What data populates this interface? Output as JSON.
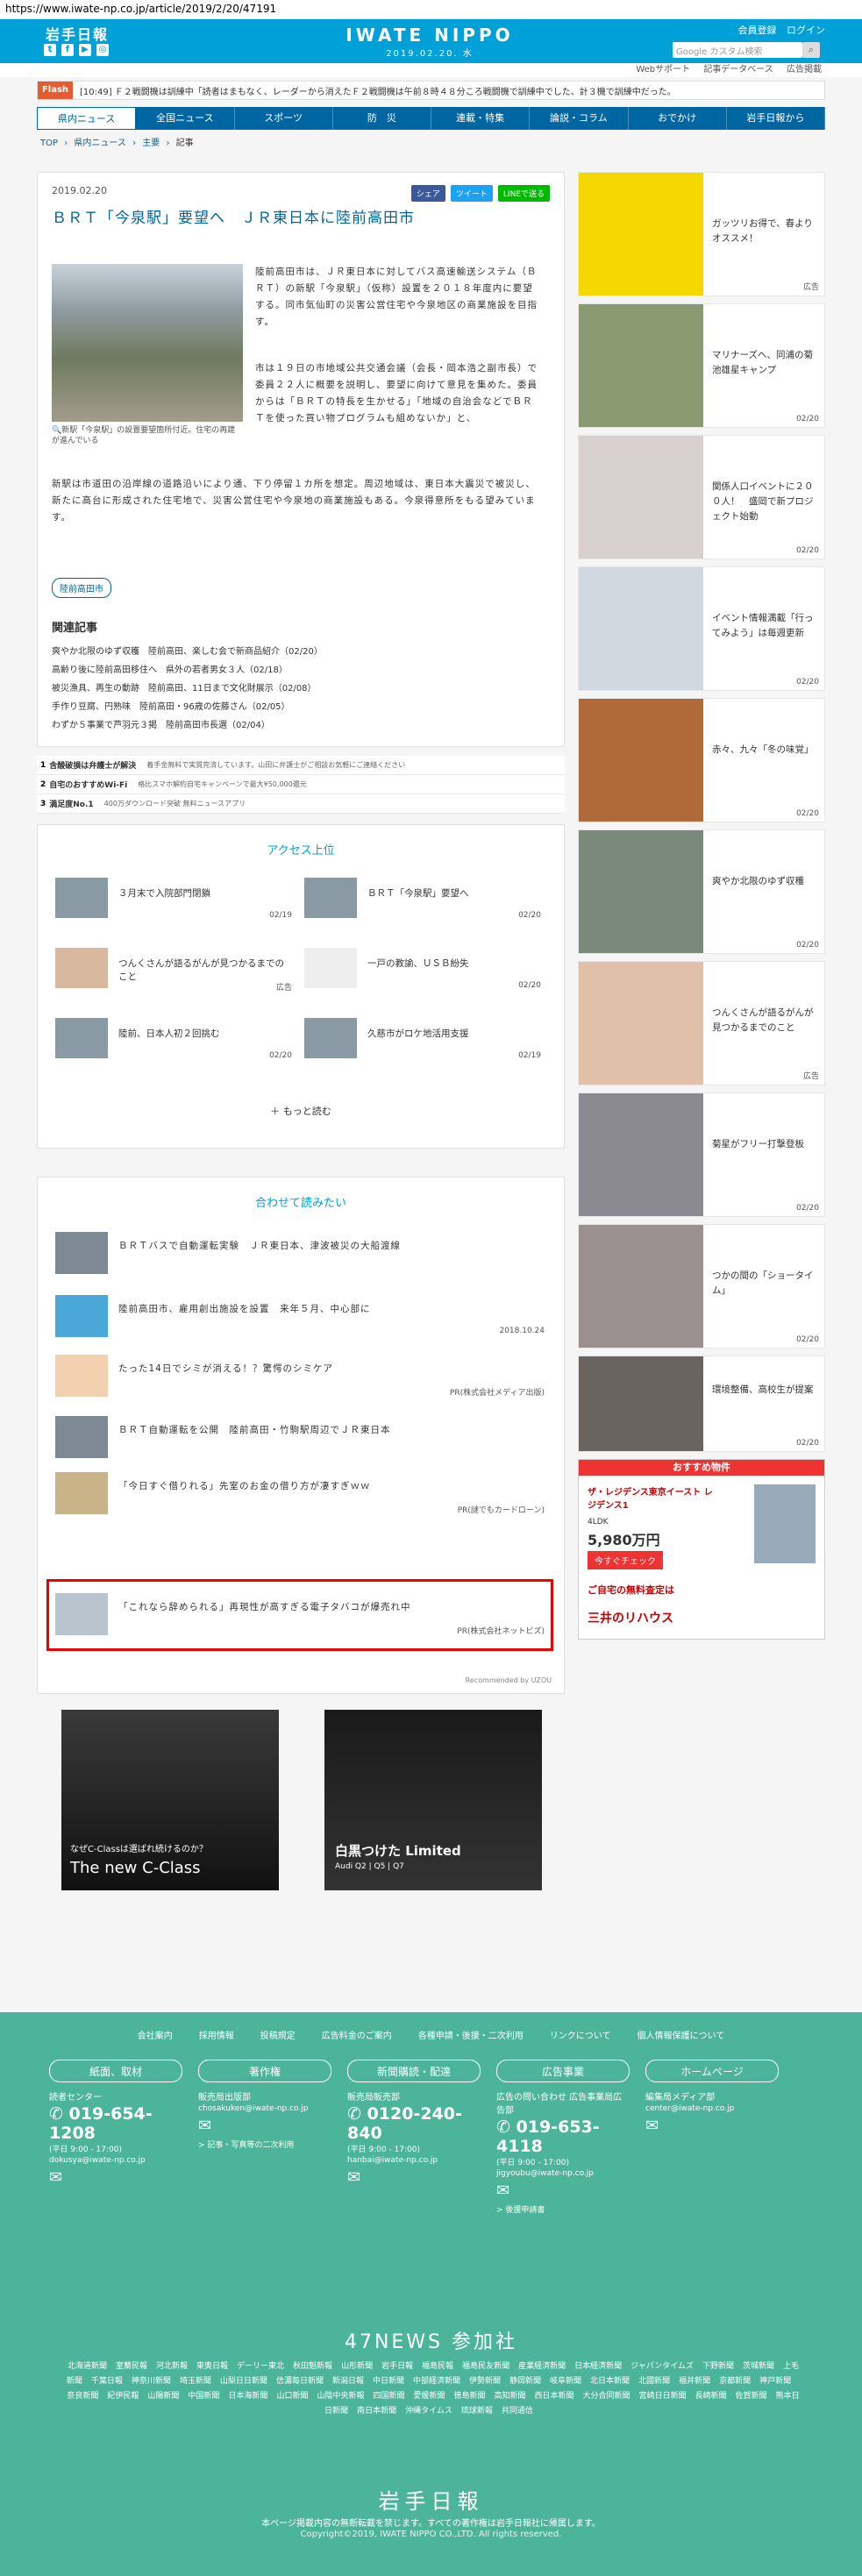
{
  "url": "https://www.iwate-np.co.jp/article/2019/2/20/47191",
  "header": {
    "logo": "岩手日報",
    "center_title": "IWATE NIPPO",
    "center_date": "2019.02.20. 水",
    "links": [
      "会員登録",
      "ログイン"
    ],
    "search_placeholder": "Google カスタム検索",
    "sub_links": [
      "Webサポート",
      "記事データベース",
      "広告掲載"
    ]
  },
  "flash": {
    "label": "Flash",
    "message": "[10:49] Ｆ２戦闘機は訓練中「読者はまもなく、レーダーから消えたＦ２戦闘機は午前８時４８分ころ戦闘機で訓練中でした、計３機で訓練中だった。"
  },
  "nav": [
    "県内ニュース",
    "全国ニュース",
    "スポーツ",
    "防　災",
    "連載・特集",
    "論説・コラム",
    "おでかけ",
    "岩手日報から"
  ],
  "breadcrumb": [
    "TOP",
    "›",
    "県内ニュース",
    "›",
    "主要",
    "›",
    "記事"
  ],
  "article": {
    "date": "2019.02.20",
    "share": [
      "シェア",
      "ツイート",
      "LINEで送る"
    ],
    "title": "ＢＲＴ「今泉駅」要望へ　ＪＲ東日本に陸前高田市",
    "caption": "新駅「今泉駅」の設置要望箇所付近。住宅の再建が進んでいる",
    "p1": "陸前高田市は、ＪＲ東日本に対してバス高速輸送システム（ＢＲＴ）の新駅「今泉駅」（仮称）設置を２０１８年度内に要望する。同市気仙町の災害公営住宅や今泉地区の商業施設を目指す。",
    "p2": "市は１９日の市地域公共交通会議（会長・岡本浩之副市長）で委員２２人に概要を説明し、要望に向けて意見を集めた。委員からは「ＢＲＴの特長を生かせる」「地域の自治会などでＢＲＴを使った買い物プログラムも組めないか」と、",
    "p3": "新駅は市道田の沿岸線の道路沿いにより通、下り停留１カ所を想定。周辺地域は、東日本大震災で被災し、新たに高台に形成された住宅地で、災害公営住宅や今泉地の商業施設もある。今泉得意所をもる望みています。",
    "tag": "陸前高田市",
    "related_title": "関連記事",
    "related": [
      "爽やか北限のゆず収穫　陸前高田、楽しむ会で新商品紹介（02/20）",
      "高齢り後に陸前高田移住へ　県外の若者男女３人（02/18）",
      "被災漁具、再生の動跡　陸前高田、11日まで文化財展示（02/08）",
      "手作り豆腐、円熟味　陸前高田・96歳の佐藤さん（02/05）",
      "わずか５事業で芦羽元３掲　陸前高田市長選（02/04）"
    ]
  },
  "text_ads": [
    {
      "n": "1",
      "title": "含酸破損は弁護士が解決",
      "sub": "着手金無料で実質完済しています。山田に弁護士がご相談お気軽にご連絡ください"
    },
    {
      "n": "2",
      "title": "自宅のおすすめWi-Fi",
      "sub": "格比スマホ解約自宅キャンペーンで最大¥50,000還元"
    },
    {
      "n": "3",
      "title": "満足度No.1",
      "sub": "400万ダウンロード突破 無料ニュースアプリ"
    }
  ],
  "access": {
    "title": "アクセス上位",
    "items": [
      {
        "text": "３月末で入院部門閉鎖",
        "date": "02/19"
      },
      {
        "text": "ＢＲＴ「今泉駅」要望へ",
        "date": "02/20"
      },
      {
        "text": "つんくさんが語るがんが見つかるまでのこと",
        "date": "広告"
      },
      {
        "text": "一戸の教諭、ＵＳＢ紛失",
        "date": "02/20"
      },
      {
        "text": "陸前、日本人初２回挑む",
        "date": "02/20"
      },
      {
        "text": "久慈市がロケ地活用支援",
        "date": "02/19"
      }
    ],
    "more": "もっと読む"
  },
  "recommend": {
    "title": "合わせて読みたい",
    "items": [
      {
        "text": "ＢＲＴバスで自動運転実験　ＪＲ東日本、津波被災の大船渡線",
        "sponsor": ""
      },
      {
        "text": "陸前高田市、雇用創出施設を設置　来年５月、中心部に",
        "sponsor": "2018.10.24"
      },
      {
        "text": "たった14日でシミが消える！？驚愕のシミケア",
        "sponsor": "PR(株式会社メディア出版)"
      },
      {
        "text": "ＢＲＴ自動運転を公開　陸前高田・竹駒駅周辺でＪＲ東日本",
        "sponsor": ""
      },
      {
        "text": "「今日すぐ借りれる」先室のお金の借り方が凄すぎｗｗ",
        "sponsor": "PR(謎でもカードローン)"
      },
      {
        "text": "「これなら辞められる」再現性が高すぎる電子タバコが爆売れ中",
        "sponsor": "PR(株式会社ネットビズ)"
      }
    ],
    "footer": "Recommended by UZOU"
  },
  "bottom_ads": [
    {
      "headline": "なぜC-Classは選ばれ続けるのか？",
      "name": "The new C-Class"
    },
    {
      "headline": "白黒つけた Limited",
      "name": "Audi Q2 | Q5 | Q7"
    }
  ],
  "sidebar": {
    "items": [
      {
        "text": "ガッツリお得で、春よりオススメ！",
        "date": "広告"
      },
      {
        "text": "マリナーズへ、同浦の菊池雄星キャンプ",
        "date": "02/20"
      },
      {
        "text": "関係人口イベントに２００人！　盛岡で新プロジェクト始動",
        "date": "02/20"
      },
      {
        "text": "イベント情報満載「行ってみよう」は毎週更新",
        "date": "02/20"
      },
      {
        "text": "赤々、九々「冬の味覚」",
        "date": "02/20"
      },
      {
        "text": "爽やか北限のゆず収穫",
        "date": "02/20"
      },
      {
        "text": "つんくさんが語るがんが見つかるまでのこと",
        "date": "広告"
      },
      {
        "text": "菊星がフリー打撃登板",
        "date": "02/20"
      },
      {
        "text": "つかの間の「ショータイム」",
        "date": "02/20"
      },
      {
        "text": "環境整備、高校生が提案",
        "date": "02/20"
      }
    ],
    "ad": {
      "header": "おすすめ物件",
      "name": "ザ・レジデンス東京イースト レジデンス1",
      "layout": "4LDK",
      "price": "5,980万円",
      "btn": "今すぐチェック",
      "cta": "ご自宅の無料査定は",
      "brand": "三井のリハウス"
    }
  },
  "footer": {
    "links": [
      "会社案内",
      "採用情報",
      "投稿規定",
      "広告料金のご案内",
      "各種申請・後援・二次利用",
      "リンクについて",
      "個人情報保護について"
    ],
    "cats": [
      {
        "h": "紙面、取材",
        "label": "読者センター",
        "phone": "019-654-1208",
        "hours": "(平日 9:00 - 17:00)",
        "email": "dokusya@iwate-np.co.jp",
        "link": ""
      },
      {
        "h": "著作権",
        "label": "販売局出版部",
        "phone": "",
        "hours": "",
        "email": "chosakuken@iwate-np.co.jp",
        "link": "> 記事・写真等の二次利用"
      },
      {
        "h": "新聞購読・配達",
        "label": "販売局販売部",
        "phone": "0120-240-840",
        "hours": "(平日 9:00 - 17:00)",
        "email": "hanbai@iwate-np.co.jp",
        "link": ""
      },
      {
        "h": "広告事業",
        "label": "広告の問い合わせ 広告事業局広告部",
        "phone": "019-653-4118",
        "hours": "(平日 9:00 - 17:00)",
        "email": "jigyoubu@iwate-np.co.jp",
        "link": "> 後援申請書"
      },
      {
        "h": "ホームページ",
        "label": "編集局メディア部",
        "phone": "",
        "hours": "",
        "email": "center@iwate-np.co.jp",
        "link": ""
      }
    ],
    "news47": "47NEWS 参加社",
    "papers": [
      "北海道新聞",
      "室蘭民報",
      "河北新報",
      "東奥日報",
      "デーリー東北",
      "秋田魁新報",
      "山形新聞",
      "岩手日報",
      "福島民報",
      "福島民友新聞",
      "産業経済新聞",
      "日本経済新聞",
      "ジャパンタイムズ",
      "下野新聞",
      "茨城新聞",
      "上毛新聞",
      "千葉日報",
      "神奈川新聞",
      "埼玉新聞",
      "山梨日日新聞",
      "信濃毎日新聞",
      "新潟日報",
      "中日新聞",
      "中部経済新聞",
      "伊勢新聞",
      "静岡新聞",
      "岐阜新聞",
      "北日本新聞",
      "北國新聞",
      "福井新聞",
      "京都新聞",
      "神戸新聞",
      "奈良新聞",
      "紀伊民報",
      "山陽新聞",
      "中国新聞",
      "日本海新聞",
      "山口新聞",
      "山陰中央新報",
      "四国新聞",
      "愛媛新聞",
      "徳島新聞",
      "高知新聞",
      "西日本新聞",
      "大分合同新聞",
      "宮崎日日新聞",
      "長崎新聞",
      "佐賀新聞",
      "熊本日日新聞",
      "南日本新聞",
      "沖縄タイムス",
      "琉球新報",
      "共同通信"
    ],
    "logo": "岩手日報",
    "note": "本ページ掲載内容の無断転載を禁じます。すべての著作権は岩手日報社に帰属します。",
    "copyright": "Copyright©2019, IWATE NIPPO CO.,LTD. All rights reserved."
  }
}
